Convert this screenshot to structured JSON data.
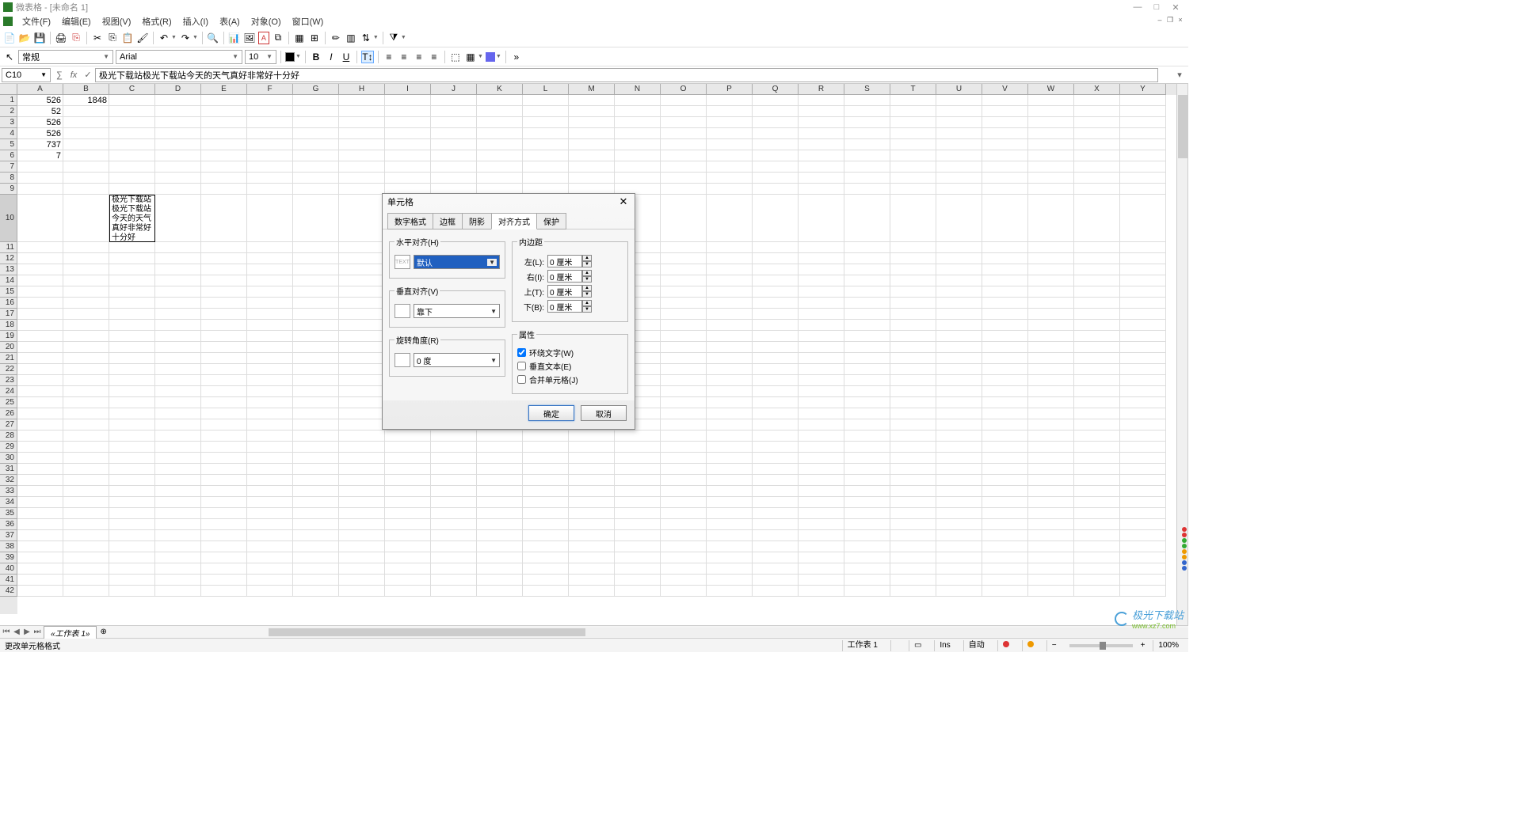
{
  "title": "微表格 - [未命名 1]",
  "menus": [
    "文件(F)",
    "编辑(E)",
    "视图(V)",
    "格式(R)",
    "插入(I)",
    "表(A)",
    "对象(O)",
    "窗口(W)"
  ],
  "format": {
    "style": "常规",
    "font": "Arial",
    "size": "10"
  },
  "cellRef": "C10",
  "formula": "极光下载站极光下载站今天的天气真好非常好十分好",
  "columns": [
    "A",
    "B",
    "C",
    "D",
    "E",
    "F",
    "G",
    "H",
    "I",
    "J",
    "K",
    "L",
    "M",
    "N",
    "O",
    "P",
    "Q",
    "R",
    "S",
    "T",
    "U",
    "V",
    "W",
    "X",
    "Y"
  ],
  "rowData": {
    "1": {
      "A": "526",
      "B": "1848"
    },
    "2": {
      "A": "52"
    },
    "3": {
      "A": "526"
    },
    "4": {
      "A": "526"
    },
    "5": {
      "A": "737"
    },
    "6": {
      "A": "7"
    }
  },
  "wrapCellText": "极光下载站极光下载站今天的天气真好非常好十分好",
  "sheetTab": "«工作表 1»",
  "statusLeft": "更改单元格格式",
  "statusSheet": "工作表 1",
  "statusIns": "Ins",
  "statusAuto": "自动",
  "statusZoom": "100%",
  "dialog": {
    "title": "单元格",
    "tabs": [
      "数字格式",
      "边框",
      "阴影",
      "对齐方式",
      "保护"
    ],
    "activeTab": 3,
    "groups": {
      "halign": "水平对齐(H)",
      "valign": "垂直对齐(V)",
      "rotate": "旋转角度(R)",
      "padding": "内边距",
      "attrs": "属性"
    },
    "halignValue": "默认",
    "valignValue": "靠下",
    "rotateValue": "0 度",
    "padLabels": {
      "left": "左(L):",
      "right": "右(I):",
      "top": "上(T):",
      "bottom": "下(B):"
    },
    "padValue": "0 厘米",
    "attrWrap": "环绕文字(W)",
    "attrVert": "垂直文本(E)",
    "attrMerge": "合并单元格(J)",
    "ok": "确定",
    "cancel": "取消"
  },
  "watermark": {
    "brand": "极光下载站",
    "url": "www.xz7.com"
  }
}
